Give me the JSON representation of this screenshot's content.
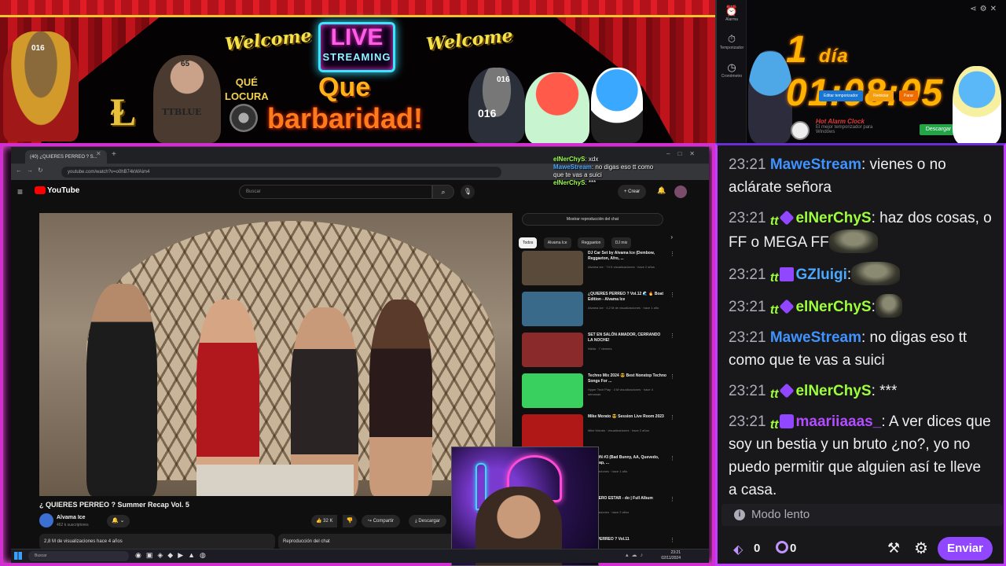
{
  "banner": {
    "welcome_left": "Welcome",
    "welcome_right": "Welcome",
    "live": "LIVE",
    "streaming": "STREAMING",
    "que_locura_1": "QUÉ",
    "que_locura_2": "LOCURA",
    "que": "Que",
    "barbaridad": "barbaridad!",
    "cat_tag": "016",
    "bald_tag": "65",
    "bald_shirt": "TTBLUE",
    "gray_cat_tag": "016",
    "gray_cat_num": "016"
  },
  "timer": {
    "side": [
      {
        "icon": "⏰",
        "label": "Alarma"
      },
      {
        "icon": "⏱",
        "label": "Temporizador"
      },
      {
        "icon": "◷",
        "label": "Cronómetro"
      }
    ],
    "days_value": "1",
    "days_label": "día",
    "time": "01:08:05",
    "btn_timer": "Editar temporizador",
    "btn_start": "Reiniciar",
    "btn_stop": "Parar",
    "brand": "Hot Alarm Clock",
    "brand_sub": "El mejor temporizador para Windows",
    "download": "Descargar"
  },
  "browser": {
    "tab_title": "(40) ¿QUIERES PERREO ? S...",
    "url": "youtube.com/watch?v=o0hB74kWAim4"
  },
  "youtube": {
    "logo": "YouTube",
    "search_placeholder": "Buscar",
    "create": "+ Crear",
    "video_title": "¿ QUIERES PERREO ? Summer Recap Vol. 5",
    "channel": "Alvama Ice",
    "subs": "462 k suscriptores",
    "likes": "32 K",
    "share": "Compartir",
    "download": "Descargar",
    "views": "2,8 M de visualizaciones  hace 4 años",
    "chat_replay_bottom": "Reproducción del chat",
    "chat_replay_btn": "Mostrar reproducción del chat",
    "chips": [
      "Todos",
      "Alvama Ice",
      "Reggaeton",
      "DJ mix"
    ],
    "recs": [
      {
        "title": "DJ Car Set by Alvama Ice (Dembow, Reggaeton, Afro, ...",
        "meta": "Alvama Ice · 74 K visualizaciones · hace 2 años",
        "color": "#5a4a3a"
      },
      {
        "title": "¿QUIERES PERREO ? Vol.12 🌊 🔥 Boat Edition - Alvama Ice",
        "meta": "Alvama Ice · 4,2 M de visualizaciones · hace 1 año",
        "color": "#3a6a8a"
      },
      {
        "title": "SET EN SALÓN AMADOR, CERRANDO LA NOCHE!",
        "meta": "Nikita · 7 viewers",
        "color": "#8a2a2a"
      },
      {
        "title": "Techno Mix 2024 😎 Best Nonstop Techno Songs For ...",
        "meta": "Hyper Tech Play · 4 M visualizaciones · hace 4 semanas",
        "color": "#3ad060"
      },
      {
        "title": "Mike Morato 😎 Session Live Room 2023",
        "meta": "Mike Morato · visualizaciones · hace 2 años",
        "color": "#b01818"
      },
      {
        "title": "SESION #3 (Bad Bunny, AA, Quevedo, Bizarrap, ...",
        "meta": "visualizaciones · hace 1 año",
        "color": "#2a2a5a"
      },
      {
        "title": "E QUIERO ESTAR - do | Full Album",
        "meta": "visualizaciones · hace 2 años",
        "color": "#4a3a6a"
      },
      {
        "title": "RES PERREO ? Vol.11",
        "meta": "",
        "color": "#3a3a3a"
      }
    ]
  },
  "mini_chat": [
    {
      "user": "elNerChyS",
      "text": ": xdx"
    },
    {
      "user": "MaweStream",
      "text": ": no digas eso tt como"
    },
    {
      "user": "",
      "text": "que te vas a suici"
    },
    {
      "user": "elNerChyS",
      "text": ": ***"
    }
  ],
  "taskbar": {
    "search": "Buscar",
    "time": "23:21",
    "date": "02/11/2024"
  },
  "chat": {
    "messages": [
      {
        "ts": "23:21",
        "user": "MaweStream",
        "text": ": vienes o no aclárate señora"
      },
      {
        "ts": "23:21",
        "user": "elNerChyS",
        "text": ": haz dos cosas, o FF o MEGA FF"
      },
      {
        "ts": "23:21",
        "user": "GZluigi",
        "text": ":"
      },
      {
        "ts": "23:21",
        "user": "elNerChyS",
        "text": ":"
      },
      {
        "ts": "23:21",
        "user": "MaweStream",
        "text": ": no digas eso tt como que te vas a suici"
      },
      {
        "ts": "23:21",
        "user": "elNerChyS",
        "text": ": ***"
      },
      {
        "ts": "23:21",
        "user": "maariiaaas_",
        "text": ": A ver dices que soy un bestia y un bruto ¿no?, yo no puedo permitir que alguien así te lleve a casa."
      }
    ],
    "slow_mode": "Modo lento",
    "points": "0",
    "bits": "0",
    "send": "Enviar",
    "badge_tt": "tt"
  },
  "colors": {
    "frame_pink": "#d22fd0",
    "twitch_purple": "#9146ff",
    "timer_orange": "#ffb300"
  }
}
